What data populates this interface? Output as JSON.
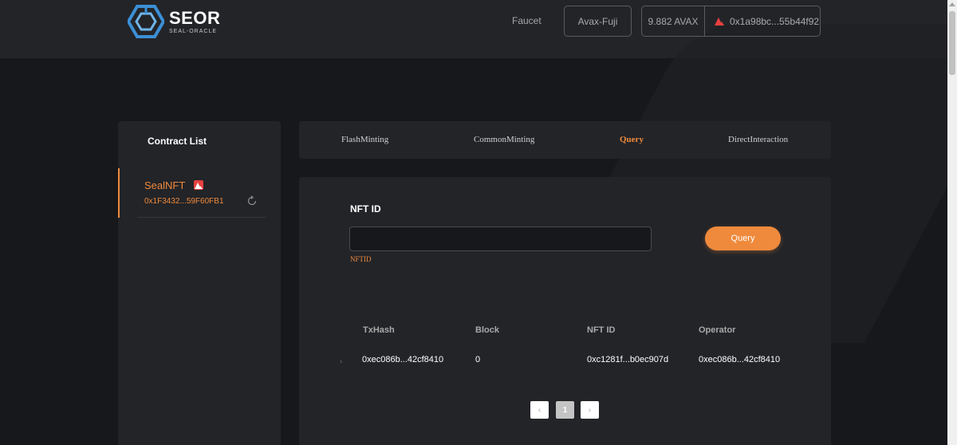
{
  "brand": {
    "name": "SEOR",
    "subtitle": "SEAL-ORACLE",
    "logo_color": "#3b8fd6"
  },
  "header": {
    "faucet_label": "Faucet",
    "network_label": "Avax-Fuji",
    "wallet_balance": "9.882 AVAX",
    "wallet_address": "0x1a98bc...55b44f92",
    "wallet_icon": "avax-icon"
  },
  "sidebar": {
    "title": "Contract List",
    "contracts": [
      {
        "name": "SealNFT",
        "address": "0x1F3432...59F60FB1",
        "badge_icon": "avax-badge-icon",
        "action_icon": "refresh-icon"
      }
    ]
  },
  "tabs": [
    {
      "label": "FlashMinting",
      "active": false
    },
    {
      "label": "CommonMinting",
      "active": false
    },
    {
      "label": "Query",
      "active": true
    },
    {
      "label": "DirectInteraction",
      "active": false
    }
  ],
  "query_form": {
    "field_label": "NFT ID",
    "input_value": "",
    "validation_message": "NFTID",
    "submit_label": "Query"
  },
  "results_table": {
    "columns": [
      "TxHash",
      "Block",
      "NFT ID",
      "Operator"
    ],
    "rows": [
      {
        "txhash": "0xec086b...42cf8410",
        "block": "0",
        "nft_id": "0xc1281f...b0ec907d",
        "operator": "0xec086b...42cf8410"
      }
    ]
  },
  "pagination": {
    "prev_label": "‹",
    "current_page": "1",
    "next_label": "›"
  },
  "colors": {
    "accent": "#ef8a3c",
    "background": "#17181b",
    "panel": "#232428",
    "badge": "#e8403f"
  }
}
